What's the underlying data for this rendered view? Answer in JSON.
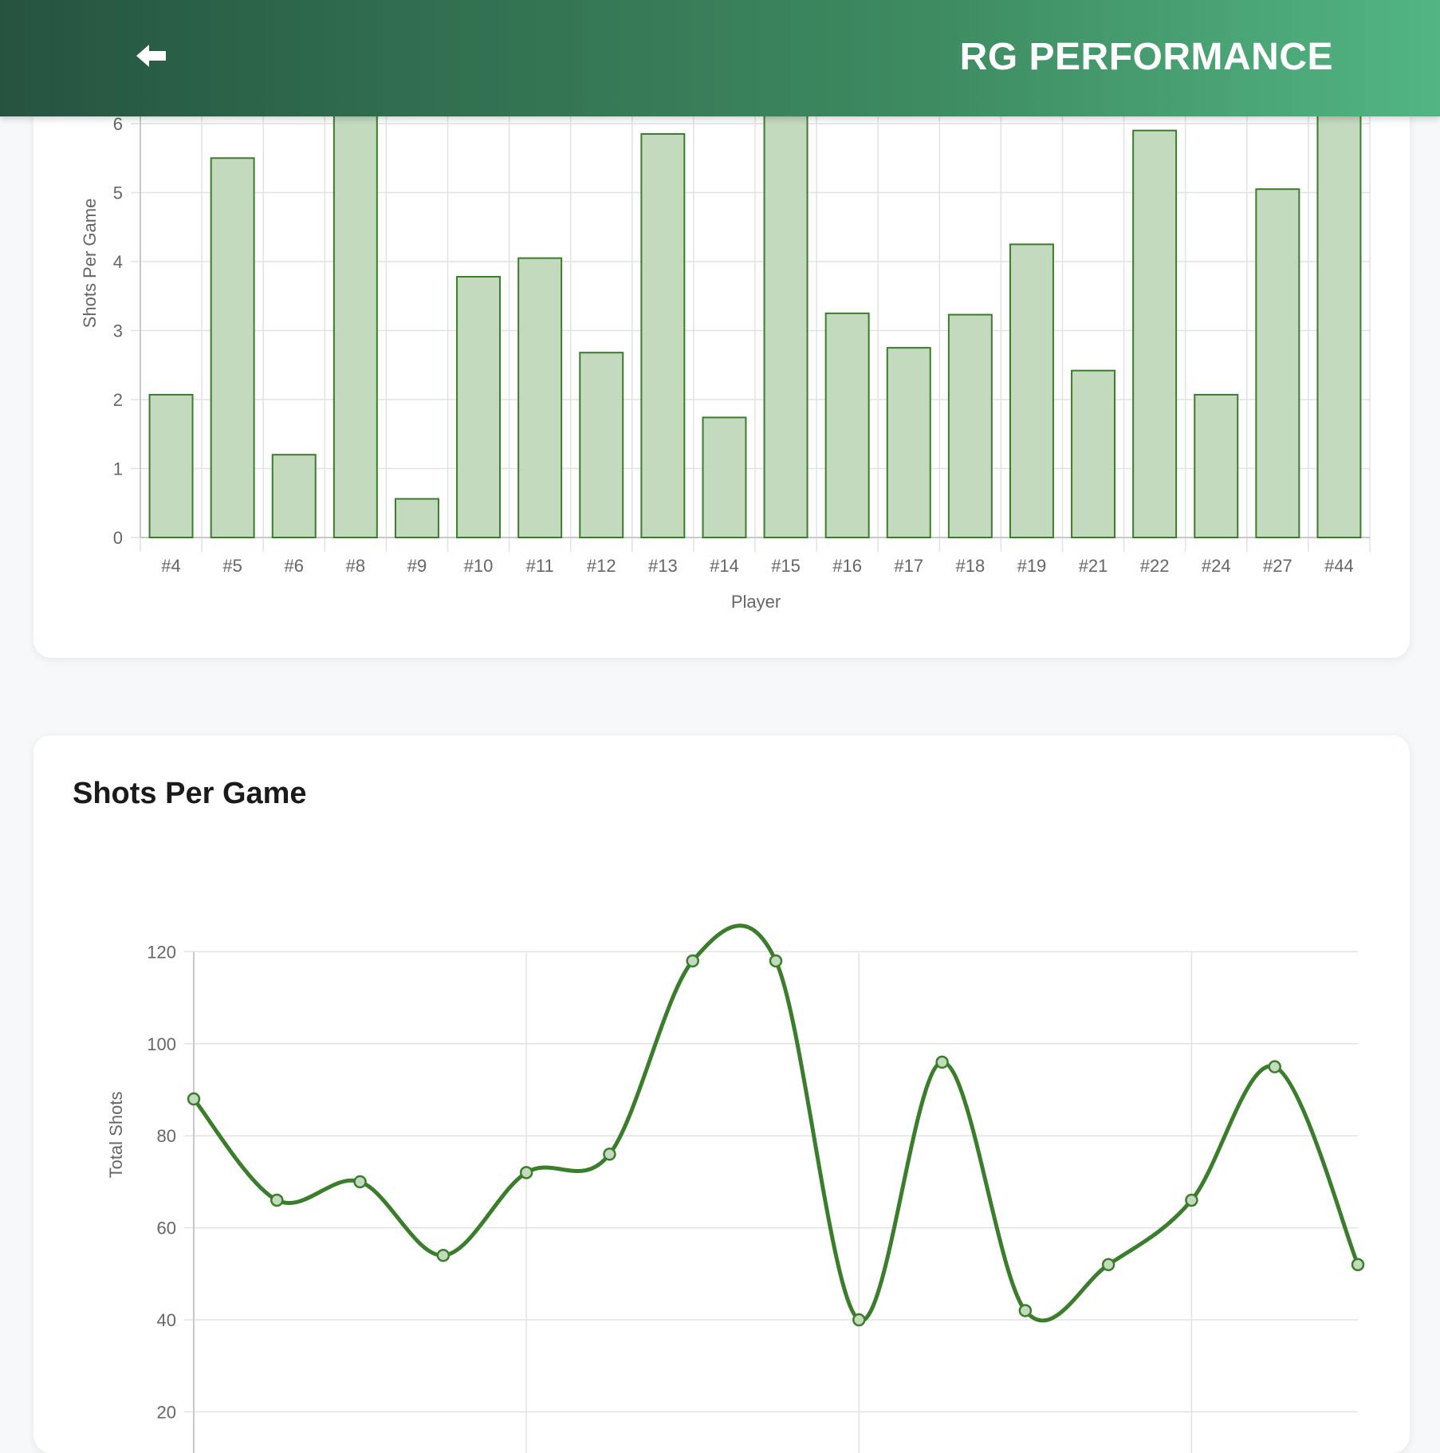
{
  "header": {
    "title": "RG PERFORMANCE",
    "back_icon": "arrow-left-icon"
  },
  "colors": {
    "accent": "#3a7d2a",
    "bar_fill": "#c4dabe",
    "grid": "#e2e2e2",
    "header_start": "#255340",
    "header_end": "#52b583"
  },
  "charts": {
    "bar": {
      "ylabel": "Shots Per Game",
      "xlabel": "Player",
      "ytick_labels": [
        "0",
        "1",
        "2",
        "3",
        "4",
        "5",
        "6"
      ]
    },
    "line": {
      "title": "Shots Per Game",
      "ylabel": "Total Shots",
      "ytick_labels": [
        "20",
        "40",
        "60",
        "80",
        "100",
        "120"
      ]
    }
  },
  "chart_data": [
    {
      "type": "bar",
      "title": "",
      "xlabel": "Player",
      "ylabel": "Shots Per Game",
      "categories": [
        "#4",
        "#5",
        "#6",
        "#8",
        "#9",
        "#10",
        "#11",
        "#12",
        "#13",
        "#14",
        "#15",
        "#16",
        "#17",
        "#18",
        "#19",
        "#21",
        "#22",
        "#24",
        "#27",
        "#44"
      ],
      "values": [
        2.07,
        5.5,
        1.2,
        6.2,
        0.56,
        3.78,
        4.05,
        2.68,
        5.85,
        1.74,
        6.2,
        3.25,
        2.75,
        3.23,
        4.25,
        2.42,
        5.9,
        2.07,
        5.05,
        6.2
      ],
      "ylim": [
        0,
        6
      ],
      "grid": true
    },
    {
      "type": "line",
      "title": "Shots Per Game",
      "xlabel": "",
      "ylabel": "Total Shots",
      "x": [
        1,
        2,
        3,
        4,
        5,
        6,
        7,
        8,
        9,
        10,
        11,
        12,
        13,
        14,
        15
      ],
      "values": [
        88,
        66,
        70,
        54,
        72,
        76,
        118,
        118,
        40,
        96,
        42,
        52,
        66,
        95,
        52
      ],
      "ylim": [
        20,
        120
      ],
      "grid": true
    }
  ]
}
